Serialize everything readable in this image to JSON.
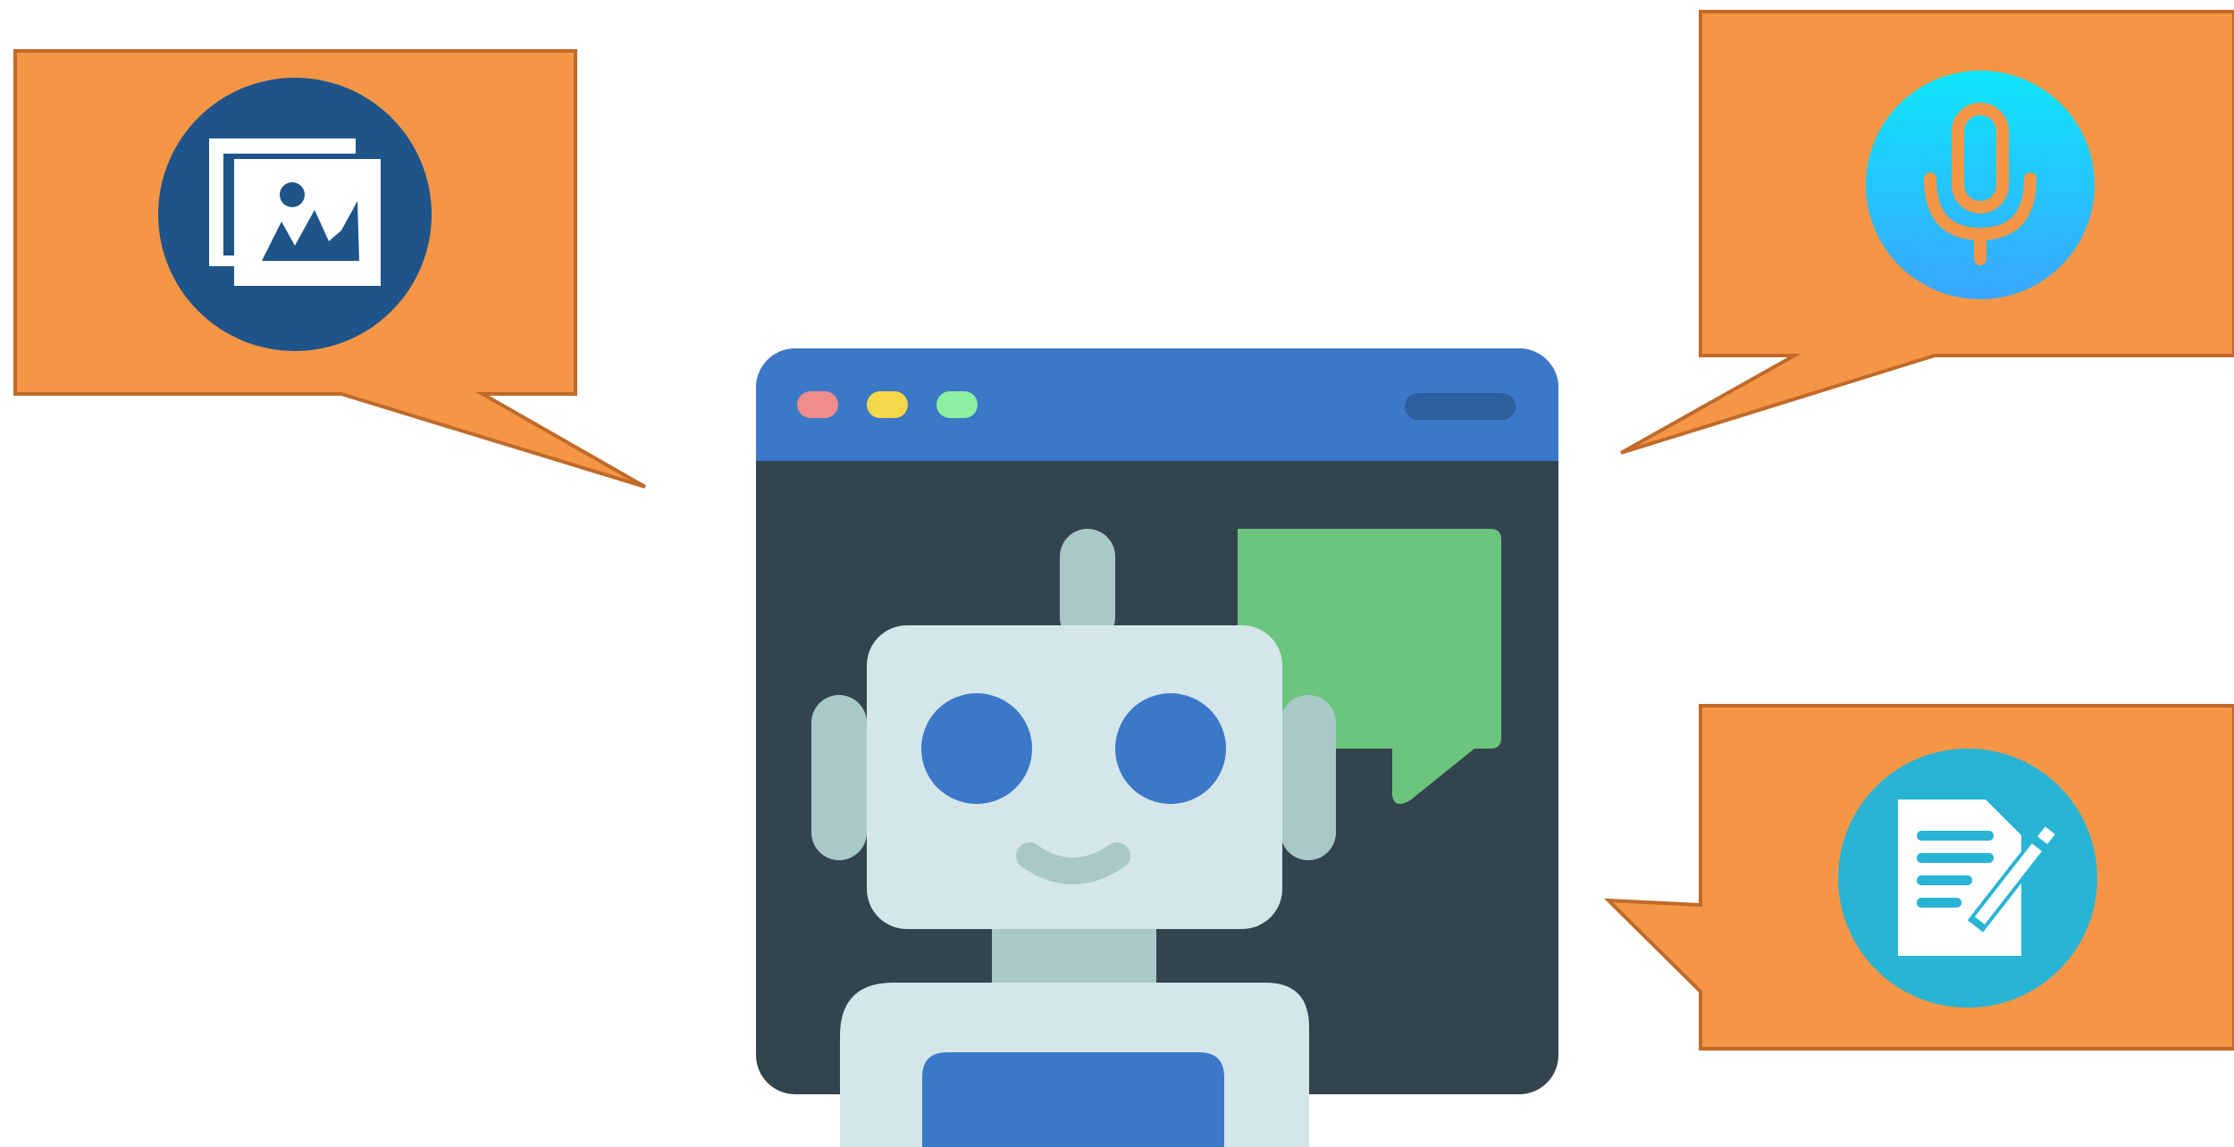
{
  "colors": {
    "background": "#ffffff",
    "callout_fill": "#f59646",
    "callout_stroke": "#c06a2a",
    "window_titlebar": "#3c78c8",
    "window_body": "#33444e",
    "window_dot_red": "#f08c8c",
    "window_dot_yellow": "#f5d84a",
    "window_dot_green": "#8cf0a0",
    "window_search_pill": "#2c5f9e",
    "chat_bubble": "#6cc57c",
    "robot_face": "#d5e6ea",
    "robot_accent": "#a9c8c8",
    "robot_eyes": "#3c78c8",
    "image_icon_circle": "#1e5489",
    "mic_icon_gradient_top": "#0ee6fb",
    "mic_icon_gradient_bottom": "#3aa6ff",
    "mic_glyph": "#f59646",
    "document_icon_circle": "#28b4d4"
  },
  "icons": {
    "image_callout": "image-gallery-icon",
    "audio_callout": "microphone-icon",
    "text_callout": "document-edit-icon",
    "center": "chatbot-robot-icon"
  }
}
